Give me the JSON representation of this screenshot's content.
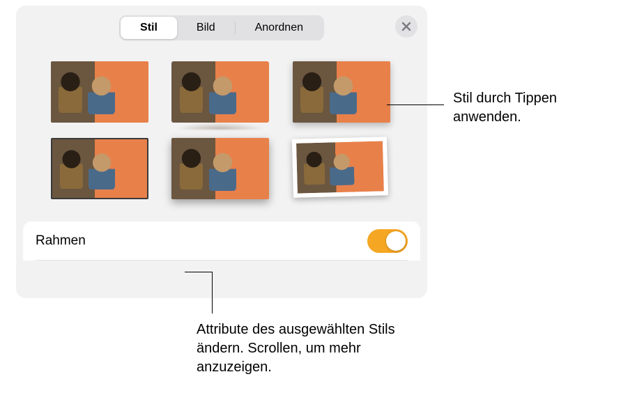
{
  "tabs": {
    "items": [
      {
        "label": "Stil",
        "active": true
      },
      {
        "label": "Bild",
        "active": false
      },
      {
        "label": "Anordnen",
        "active": false
      }
    ]
  },
  "styles": {
    "items": [
      {
        "name": "style-plain"
      },
      {
        "name": "style-reflection"
      },
      {
        "name": "style-shadow-soft"
      },
      {
        "name": "style-border"
      },
      {
        "name": "style-shadow-strong"
      },
      {
        "name": "style-polaroid"
      }
    ]
  },
  "options": {
    "frame": {
      "label": "Rahmen",
      "enabled": true
    }
  },
  "callouts": {
    "apply": "Stil durch Tippen anwenden.",
    "attributes": "Attribute des ausgewählten Stils ändern. Scrollen, um mehr anzuzeigen."
  },
  "colors": {
    "accent": "#f5a623"
  }
}
